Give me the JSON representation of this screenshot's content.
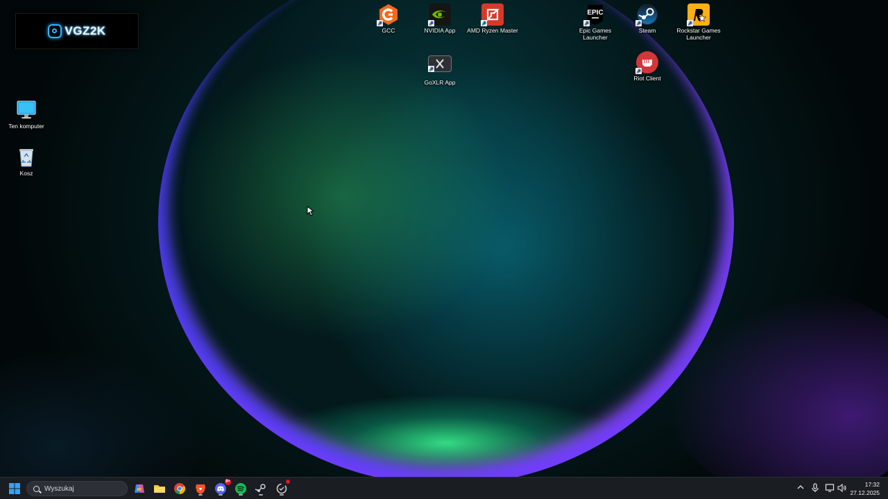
{
  "widget": {
    "brand_text": "VGZ2K"
  },
  "desktop_icons": {
    "computer": "Ten komputer",
    "recycle_bin": "Kosz",
    "gcc": "GCC",
    "nvidia": "NVIDIA App",
    "amd": "AMD Ryzen Master",
    "goxlr": "GoXLR App",
    "epic": "Epic Games Launcher",
    "epic_logo": "EPIC",
    "steam": "Steam",
    "rockstar": "Rockstar Games Launcher",
    "riot": "Riot Client"
  },
  "taskbar": {
    "search_placeholder": "Wyszukaj",
    "discord_badge": "9+",
    "clock_time": "17:32",
    "clock_date": "27.12.2025"
  },
  "colors": {
    "accent": "#2fb7ff",
    "taskbar": "#1a1d22",
    "spotify": "#1db954",
    "riot": "#d13639"
  }
}
